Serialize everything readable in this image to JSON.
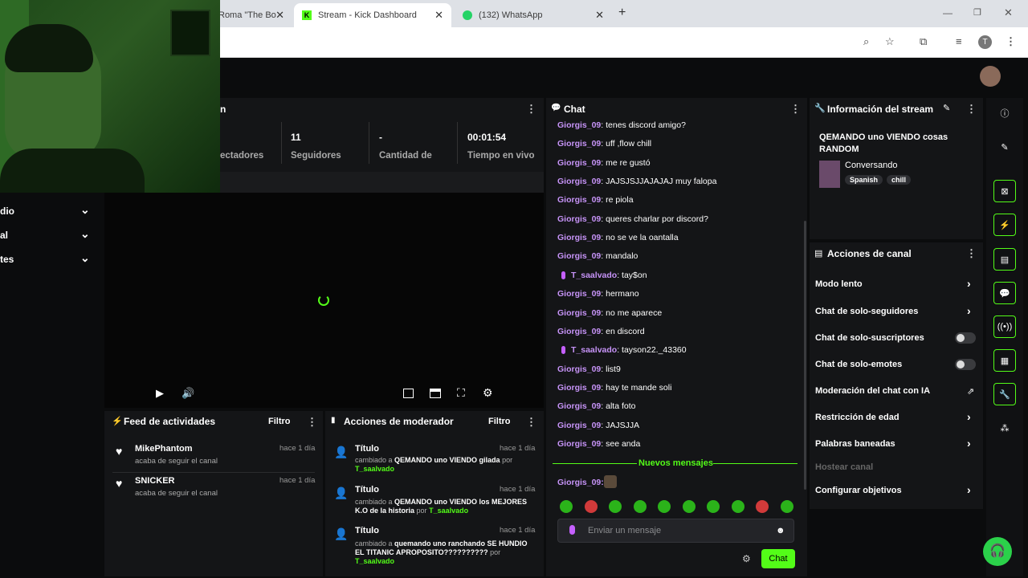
{
  "browser": {
    "tabs": [
      {
        "label": "Roma \"The Bo"
      },
      {
        "label": "Stream - Kick Dashboard"
      },
      {
        "label": "(132) WhatsApp"
      }
    ],
    "new_tab": "+",
    "profile_initial": "T"
  },
  "stream_panel": {
    "title_partial": "n",
    "stats": [
      {
        "value": "",
        "label": "ectadores"
      },
      {
        "value": "11",
        "label": "Seguidores"
      },
      {
        "value": "-",
        "label": "Cantidad de"
      },
      {
        "value": "00:01:54",
        "label": "Tiempo en vivo"
      }
    ]
  },
  "left_nav": [
    {
      "label": "dio"
    },
    {
      "label": "al"
    },
    {
      "label": "tes"
    }
  ],
  "feed": {
    "title": "Feed de actividades",
    "filter": "Filtro",
    "items": [
      {
        "name": "MikePhantom",
        "sub": "acaba de seguir el canal",
        "time": "hace 1 día"
      },
      {
        "name": "SNICKER",
        "sub": "acaba de seguir el canal",
        "time": "hace 1 día"
      }
    ]
  },
  "mod": {
    "title": "Acciones de moderador",
    "filter": "Filtro",
    "items": [
      {
        "title": "Título",
        "prefix": "cambiado a",
        "text": "QEMANDO uno VIENDO gilada",
        "by": "por",
        "user": "T_saalvado",
        "time": "hace 1 día"
      },
      {
        "title": "Título",
        "prefix": "cambiado a",
        "text": "QEMANDO uno VIENDO los MEJORES K.O de la historia",
        "by": "por",
        "user": "T_saalvado",
        "time": "hace 1 día"
      },
      {
        "title": "Título",
        "prefix": "cambiado a",
        "text": "quemando uno ranchando SE HUNDIO EL TITANIC APROPOSITO??????????",
        "by": "por",
        "user": "T_saalvado",
        "time": "hace 1 día"
      }
    ]
  },
  "chat": {
    "title": "Chat",
    "messages": [
      {
        "user": "Giorgis_09",
        "text": ": tenes discord amigo?"
      },
      {
        "user": "Giorgis_09",
        "text": ": uff ,flow chill"
      },
      {
        "user": "Giorgis_09",
        "text": ": me re gustó"
      },
      {
        "user": "Giorgis_09",
        "text": ": JAJSJSJJAJAJAJ muy falopa"
      },
      {
        "user": "Giorgis_09",
        "text": ": re piola"
      },
      {
        "user": "Giorgis_09",
        "text": ": queres charlar por discord?"
      },
      {
        "user": "Giorgis_09",
        "text": ": no se ve la oantalla"
      },
      {
        "user": "Giorgis_09",
        "text": ": mandalo"
      },
      {
        "user": "T_saalvado",
        "text": ": tay$on",
        "mic": true
      },
      {
        "user": "Giorgis_09",
        "text": ": hermano"
      },
      {
        "user": "Giorgis_09",
        "text": ": no me aparece"
      },
      {
        "user": "Giorgis_09",
        "text": ": en discord"
      },
      {
        "user": "T_saalvado",
        "text": ": tayson22._43360",
        "mic": true
      },
      {
        "user": "Giorgis_09",
        "text": ": list9"
      },
      {
        "user": "Giorgis_09",
        "text": ": hay te mande soli"
      },
      {
        "user": "Giorgis_09",
        "text": ": alta foto"
      },
      {
        "user": "Giorgis_09",
        "text": ": JAJSJJA"
      },
      {
        "user": "Giorgis_09",
        "text": ": see anda"
      }
    ],
    "new_messages": "Nuevos mensajes",
    "last_user": "Giorgis_09:",
    "placeholder": "Enviar un mensaje",
    "send": "Chat"
  },
  "stream_info": {
    "title": "Información del stream",
    "stream_title": "QEMANDO uno VIENDO cosas RANDOM",
    "category": "Conversando",
    "tags": [
      "Spanish",
      "chill"
    ]
  },
  "canal": {
    "title": "Acciones de canal",
    "rows": [
      {
        "label": "Modo lento",
        "kind": "chev"
      },
      {
        "label": "Chat de solo-seguidores",
        "kind": "chev"
      },
      {
        "label": "Chat de solo-suscriptores",
        "kind": "toggle"
      },
      {
        "label": "Chat de solo-emotes",
        "kind": "toggle"
      },
      {
        "label": "Moderación del chat con IA",
        "kind": "ext"
      },
      {
        "label": "Restricción de edad",
        "kind": "chev"
      },
      {
        "label": "Palabras baneadas",
        "kind": "chev"
      },
      {
        "label": "Hostear canal",
        "kind": "disabled"
      },
      {
        "label": "Configurar objetivos",
        "kind": "chev"
      }
    ]
  },
  "colors": {
    "accent": "#53fc18",
    "username": "#c693f7",
    "panel": "#141517",
    "bg": "#0b0c0d"
  }
}
